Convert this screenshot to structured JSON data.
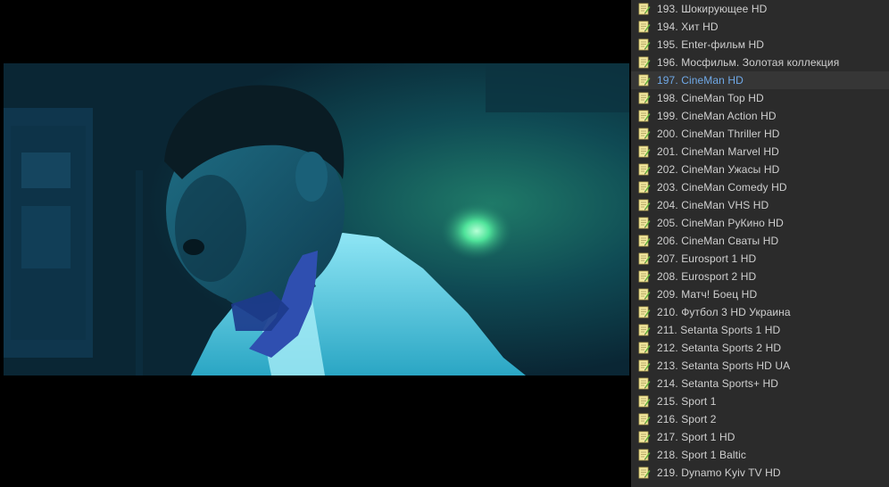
{
  "colors": {
    "player_background": "#000000",
    "playlist_background": "#2b2b2b",
    "selected_row_background": "#363636",
    "item_text": "#cfcfcf",
    "selected_item_text": "#6fa8e6",
    "icon_note_yellow": "#f2e8a0",
    "icon_pencil_green": "#5fb33a"
  },
  "video": {
    "icon": "video-frame"
  },
  "playlist": {
    "selected_index": 4,
    "items": [
      {
        "label": "193. Шокирующее HD",
        "icon": "playlist-entry-icon"
      },
      {
        "label": "194. Хит HD",
        "icon": "playlist-entry-icon"
      },
      {
        "label": "195. Enter-фильм HD",
        "icon": "playlist-entry-icon"
      },
      {
        "label": "196. Мосфильм. Золотая коллекция",
        "icon": "playlist-entry-icon"
      },
      {
        "label": "197. CineMan HD",
        "icon": "playlist-entry-icon"
      },
      {
        "label": "198. CineMan Top HD",
        "icon": "playlist-entry-icon"
      },
      {
        "label": "199. CineMan Action HD",
        "icon": "playlist-entry-icon"
      },
      {
        "label": "200. CineMan Thriller HD",
        "icon": "playlist-entry-icon"
      },
      {
        "label": "201. CineMan Marvel HD",
        "icon": "playlist-entry-icon"
      },
      {
        "label": "202. CineMan Ужасы HD",
        "icon": "playlist-entry-icon"
      },
      {
        "label": "203. CineMan Comedy HD",
        "icon": "playlist-entry-icon"
      },
      {
        "label": "204. CineMan VHS HD",
        "icon": "playlist-entry-icon"
      },
      {
        "label": "205. CineMan РуКино HD",
        "icon": "playlist-entry-icon"
      },
      {
        "label": "206. CineMan Сваты HD",
        "icon": "playlist-entry-icon"
      },
      {
        "label": "207. Eurosport 1 HD",
        "icon": "playlist-entry-icon"
      },
      {
        "label": "208. Eurosport 2 HD",
        "icon": "playlist-entry-icon"
      },
      {
        "label": "209. Матч! Боец HD",
        "icon": "playlist-entry-icon"
      },
      {
        "label": "210. Футбол 3 HD Украина",
        "icon": "playlist-entry-icon"
      },
      {
        "label": "211. Setanta Sports 1 HD",
        "icon": "playlist-entry-icon"
      },
      {
        "label": "212. Setanta Sports 2 HD",
        "icon": "playlist-entry-icon"
      },
      {
        "label": "213. Setanta Sports HD UA",
        "icon": "playlist-entry-icon"
      },
      {
        "label": "214. Setanta Sports+ HD",
        "icon": "playlist-entry-icon"
      },
      {
        "label": "215. Sport 1",
        "icon": "playlist-entry-icon"
      },
      {
        "label": "216. Sport 2",
        "icon": "playlist-entry-icon"
      },
      {
        "label": "217. Sport 1 HD",
        "icon": "playlist-entry-icon"
      },
      {
        "label": "218. Sport 1 Baltic",
        "icon": "playlist-entry-icon"
      },
      {
        "label": "219. Dynamo Kyiv TV HD",
        "icon": "playlist-entry-icon"
      }
    ]
  }
}
